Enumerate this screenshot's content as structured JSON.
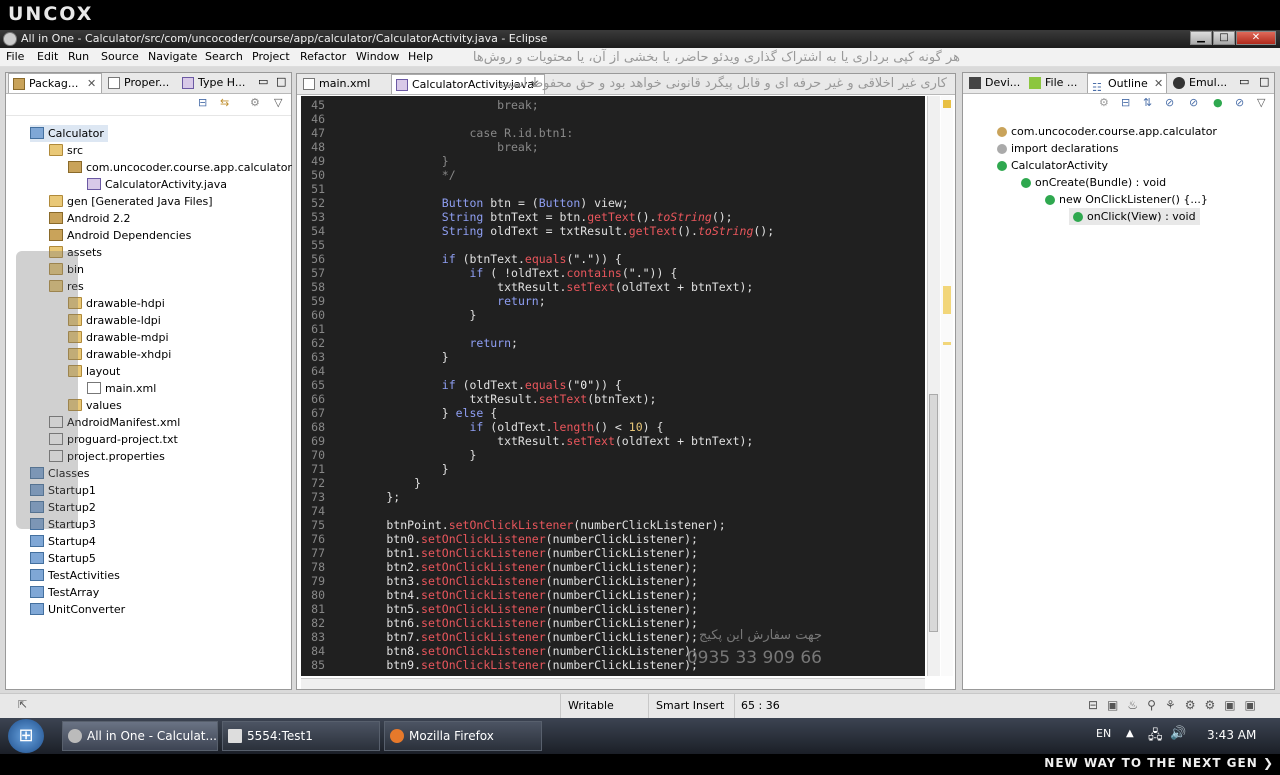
{
  "brand": {
    "logo": "UNCOX",
    "tagline": "NEW WAY TO THE NEXT GEN ❯"
  },
  "window": {
    "title": "All in One - Calculator/src/com/uncocoder/course/app/calculator/CalculatorActivity.java - Eclipse",
    "btn_min": "▁",
    "btn_max": "□",
    "btn_close": "✕"
  },
  "menu": [
    "File",
    "Edit",
    "Run",
    "Source",
    "Navigate",
    "Search",
    "Project",
    "Refactor",
    "Window",
    "Help"
  ],
  "watermark": {
    "line1": "هر گونه کپی برداری یا به اشتراک گذاری ویدئو حاضر، یا بخشی از آن، یا محتویات و روش‌ها",
    "line2": "کاری غیر اخلاقی و غیر حرفه ای و قابل پیگرد قانونی خواهد بود و حق محفوظ است",
    "line3": "جهت سفارش این پکیج",
    "phone": "0935 33 909 66"
  },
  "left_panel": {
    "tabs": [
      "Packag...",
      "Proper...",
      "Type H..."
    ],
    "tree": [
      {
        "label": "Calculator",
        "icon": "project",
        "depth": 1
      },
      {
        "label": "src",
        "icon": "folder",
        "depth": 2
      },
      {
        "label": "com.uncocoder.course.app.calculator",
        "icon": "package",
        "depth": 3
      },
      {
        "label": "CalculatorActivity.java",
        "icon": "java",
        "depth": 4
      },
      {
        "label": "gen [Generated Java Files]",
        "icon": "folder",
        "depth": 2
      },
      {
        "label": "Android 2.2",
        "icon": "lib",
        "depth": 2
      },
      {
        "label": "Android Dependencies",
        "icon": "lib",
        "depth": 2
      },
      {
        "label": "assets",
        "icon": "folder",
        "depth": 2
      },
      {
        "label": "bin",
        "icon": "folder",
        "depth": 2
      },
      {
        "label": "res",
        "icon": "folder",
        "depth": 2
      },
      {
        "label": "drawable-hdpi",
        "icon": "folder",
        "depth": 3
      },
      {
        "label": "drawable-ldpi",
        "icon": "folder",
        "depth": 3
      },
      {
        "label": "drawable-mdpi",
        "icon": "folder",
        "depth": 3
      },
      {
        "label": "drawable-xhdpi",
        "icon": "folder",
        "depth": 3
      },
      {
        "label": "layout",
        "icon": "folder",
        "depth": 3
      },
      {
        "label": "main.xml",
        "icon": "file",
        "depth": 4
      },
      {
        "label": "values",
        "icon": "folder",
        "depth": 3
      },
      {
        "label": "AndroidManifest.xml",
        "icon": "file",
        "depth": 2
      },
      {
        "label": "proguard-project.txt",
        "icon": "file",
        "depth": 2
      },
      {
        "label": "project.properties",
        "icon": "file",
        "depth": 2
      },
      {
        "label": "Classes",
        "icon": "project",
        "depth": 1
      },
      {
        "label": "Startup1",
        "icon": "project",
        "depth": 1
      },
      {
        "label": "Startup2",
        "icon": "project",
        "depth": 1
      },
      {
        "label": "Startup3",
        "icon": "project",
        "depth": 1
      },
      {
        "label": "Startup4",
        "icon": "project",
        "depth": 1
      },
      {
        "label": "Startup5",
        "icon": "project",
        "depth": 1
      },
      {
        "label": "TestActivities",
        "icon": "project",
        "depth": 1
      },
      {
        "label": "TestArray",
        "icon": "project",
        "depth": 1
      },
      {
        "label": "UnitConverter",
        "icon": "project",
        "depth": 1
      }
    ]
  },
  "editor": {
    "tabs": [
      "main.xml",
      "CalculatorActivity.java"
    ],
    "lines": [
      {
        "n": "45",
        "html": "                        break;"
      },
      {
        "n": "46",
        "html": ""
      },
      {
        "n": "47",
        "html": "                    case R.id.btn1:"
      },
      {
        "n": "48",
        "html": "                        break;"
      },
      {
        "n": "49",
        "html": "                }"
      },
      {
        "n": "50",
        "html": "                */"
      },
      {
        "n": "51",
        "html": ""
      },
      {
        "n": "52",
        "html": "                Button btn = (Button) view;"
      },
      {
        "n": "53",
        "html": "                String btnText = btn.getText().toString();"
      },
      {
        "n": "54",
        "html": "                String oldText = txtResult.getText().toString();"
      },
      {
        "n": "55",
        "html": ""
      },
      {
        "n": "56",
        "html": "                if (btnText.equals(\".\")) {"
      },
      {
        "n": "57",
        "html": "                    if ( !oldText.contains(\".\")) {"
      },
      {
        "n": "58",
        "html": "                        txtResult.setText(oldText + btnText);"
      },
      {
        "n": "59",
        "html": "                        return;"
      },
      {
        "n": "60",
        "html": "                    }"
      },
      {
        "n": "61",
        "html": ""
      },
      {
        "n": "62",
        "html": "                    return;"
      },
      {
        "n": "63",
        "html": "                }"
      },
      {
        "n": "64",
        "html": ""
      },
      {
        "n": "65",
        "html": "                if (oldText.equals(\"0\")) {"
      },
      {
        "n": "66",
        "html": "                    txtResult.setText(btnText);"
      },
      {
        "n": "67",
        "html": "                } else {"
      },
      {
        "n": "68",
        "html": "                    if (oldText.length() < 10) {"
      },
      {
        "n": "69",
        "html": "                        txtResult.setText(oldText + btnText);"
      },
      {
        "n": "70",
        "html": "                    }"
      },
      {
        "n": "71",
        "html": "                }"
      },
      {
        "n": "72",
        "html": "            }"
      },
      {
        "n": "73",
        "html": "        };"
      },
      {
        "n": "74",
        "html": ""
      },
      {
        "n": "75",
        "html": "        btnPoint.setOnClickListener(numberClickListener);"
      },
      {
        "n": "76",
        "html": "        btn0.setOnClickListener(numberClickListener);"
      },
      {
        "n": "77",
        "html": "        btn1.setOnClickListener(numberClickListener);"
      },
      {
        "n": "78",
        "html": "        btn2.setOnClickListener(numberClickListener);"
      },
      {
        "n": "79",
        "html": "        btn3.setOnClickListener(numberClickListener);"
      },
      {
        "n": "80",
        "html": "        btn4.setOnClickListener(numberClickListener);"
      },
      {
        "n": "81",
        "html": "        btn5.setOnClickListener(numberClickListener);"
      },
      {
        "n": "82",
        "html": "        btn6.setOnClickListener(numberClickListener);"
      },
      {
        "n": "83",
        "html": "        btn7.setOnClickListener(numberClickListener);"
      },
      {
        "n": "84",
        "html": "        btn8.setOnClickListener(numberClickListener);"
      },
      {
        "n": "85",
        "html": "        btn9.setOnClickListener(numberClickListener);"
      }
    ]
  },
  "right_panel": {
    "tabs": [
      "Devi...",
      "File ...",
      "Outline",
      "Emul..."
    ],
    "outline": [
      {
        "label": "com.uncocoder.course.app.calculator",
        "depth": 1
      },
      {
        "label": "import declarations",
        "depth": 1
      },
      {
        "label": "CalculatorActivity",
        "depth": 1
      },
      {
        "label": "onCreate(Bundle) : void",
        "depth": 2
      },
      {
        "label": "new OnClickListener() {...}",
        "depth": 3
      },
      {
        "label": "onClick(View) : void",
        "depth": 4
      }
    ]
  },
  "status": {
    "writable": "Writable",
    "insert_mode": "Smart Insert",
    "position": "65 : 36"
  },
  "taskbar": {
    "start": "⊞",
    "items": [
      "All in One - Calculat...",
      "5554:Test1",
      "Mozilla Firefox"
    ],
    "lang": "EN",
    "clock": "3:43 AM"
  }
}
